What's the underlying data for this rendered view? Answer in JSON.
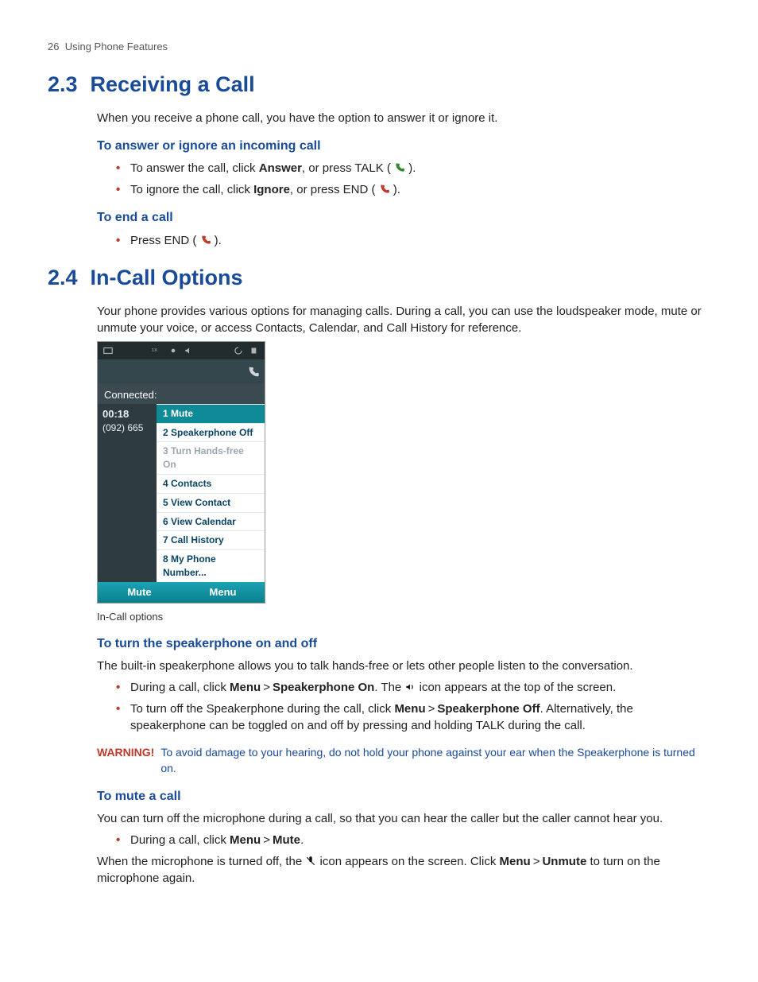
{
  "page": {
    "number": "26",
    "title": "Using Phone Features"
  },
  "s1": {
    "num": "2.3",
    "title": "Receiving a Call",
    "intro": "When you receive a phone call, you have the option to answer it or ignore it.",
    "sub1": "To answer or ignore an incoming call",
    "b1a": "To answer the call, click ",
    "b1a_bold": "Answer",
    "b1a_tail": ", or press TALK ( ",
    "b1a_close": " ).",
    "b1b": "To ignore the call, click ",
    "b1b_bold": "Ignore",
    "b1b_tail": ", or press END ( ",
    "b1b_close": " ).",
    "sub2": "To end a call",
    "b2": "Press END ( ",
    "b2_close": " )."
  },
  "s2": {
    "num": "2.4",
    "title": "In-Call Options",
    "intro": "Your phone provides various options for managing calls. During a call, you can use the loudspeaker mode, mute or unmute your voice, or access Contacts, Calendar, and Call History for reference.",
    "caption": "In-Call options",
    "spk_h": "To turn the speakerphone on and off",
    "spk_p": "The built-in speakerphone allows you to talk hands-free or lets other people listen to the conversation.",
    "spk_b1a": "During a call, click ",
    "spk_b1_menu": "Menu",
    "spk_b1_gt": ">",
    "spk_b1_sp": "Speakerphone On",
    "spk_b1_tail": ". The ",
    "spk_b1_tail2": " icon appears at the top of the screen.",
    "spk_b2a": "To turn off the Speakerphone during the call, click ",
    "spk_b2_menu": "Menu",
    "spk_b2_sp": "Speakerphone Off",
    "spk_b2_tail": ". Alternatively, the speakerphone can be toggled on and off by pressing and holding TALK during the call.",
    "warn_label": "WARNING!",
    "warn_text": "To avoid damage to your hearing, do not hold your phone against your ear when the Speakerphone is turned on.",
    "mute_h": "To mute a call",
    "mute_p": "You can turn off the microphone during a call, so that you can hear the caller but the caller cannot hear you.",
    "mute_b1a": "During a call, click ",
    "mute_b1_menu": "Menu",
    "mute_b1_m": "Mute",
    "mute_b1_tail": ".",
    "mute_p2a": "When the microphone is turned off, the ",
    "mute_p2b": " icon appears on the screen. Click ",
    "mute_p2_menu": "Menu",
    "mute_p2_un": "Unmute",
    "mute_p2_tail": " to turn on the microphone again."
  },
  "phone": {
    "connected": "Connected:",
    "time": "00:18",
    "number": "(092) 665",
    "menu": [
      {
        "n": "1",
        "t": "Mute",
        "sel": true
      },
      {
        "n": "2",
        "t": "Speakerphone Off"
      },
      {
        "n": "3",
        "t": "Turn Hands-free On",
        "dis": true
      },
      {
        "n": "4",
        "t": "Contacts"
      },
      {
        "n": "5",
        "t": "View Contact"
      },
      {
        "n": "6",
        "t": "View Calendar"
      },
      {
        "n": "7",
        "t": "Call History"
      },
      {
        "n": "8",
        "t": "My Phone Number..."
      }
    ],
    "soft_left": "Mute",
    "soft_right": "Menu"
  }
}
